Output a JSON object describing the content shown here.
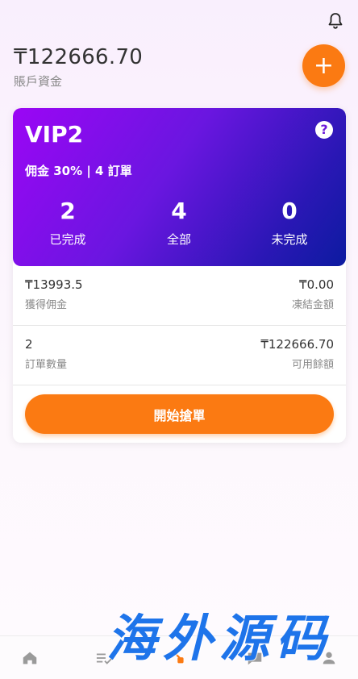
{
  "header": {
    "balance": "₸122666.70",
    "balance_label": "賬戶資金",
    "add_label": "+"
  },
  "vip_card": {
    "title": "VIP2",
    "help_label": "?",
    "subtitle": "佣金 30% | 4 訂單",
    "stats": [
      {
        "value": "2",
        "label": "已完成"
      },
      {
        "value": "4",
        "label": "全部"
      },
      {
        "value": "0",
        "label": "未完成"
      }
    ]
  },
  "details": {
    "rows": [
      {
        "left_value": "₸13993.5",
        "left_label": "獲得佣金",
        "right_value": "₸0.00",
        "right_label": "凍結金額"
      },
      {
        "left_value": "2",
        "left_label": "訂單數量",
        "right_value": "₸122666.70",
        "right_label": "可用餘額"
      }
    ]
  },
  "actions": {
    "start_label": "開始搶單"
  },
  "tabbar": {
    "items": [
      {
        "icon": "home-icon"
      },
      {
        "icon": "checklist-icon"
      },
      {
        "icon": "grab-icon"
      },
      {
        "icon": "message-icon"
      },
      {
        "icon": "user-icon"
      }
    ]
  },
  "watermark": {
    "text": "海外源码"
  },
  "colors": {
    "accent": "#fb7a12",
    "vip_gradient_start": "#9b06f5",
    "vip_gradient_end": "#0c1ba0",
    "watermark": "#1e74ea"
  }
}
